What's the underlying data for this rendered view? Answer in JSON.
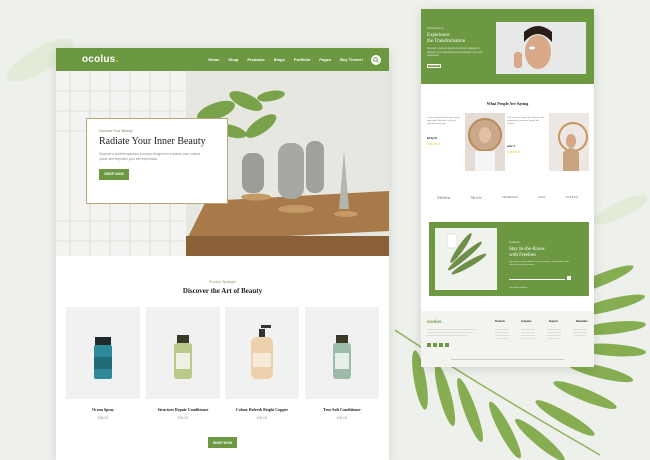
{
  "left_page": {
    "logo": "ocolus",
    "nav": [
      "Home",
      "Shop",
      "Products",
      "Blogs",
      "Portfolio",
      "Pages",
      "Buy Theme!"
    ],
    "hero": {
      "eyebrow": "Discover Your Beauty",
      "title": "Radiate Your Inner Beauty",
      "description": "Discover a content spacious luminary designed to enhance your natural power and empower your self-expression.",
      "button": "SHOP NOW"
    },
    "spotlight": {
      "eyebrow": "Product Spotlight",
      "title": "Discover the Art of Beauty"
    },
    "products": [
      {
        "name": "Ocean Spray",
        "price": "$38.00"
      },
      {
        "name": "Structure Repair Conditioner",
        "price": "$34.00"
      },
      {
        "name": "Colour Refresh Bright Copper",
        "price": "$38.00"
      },
      {
        "name": "True Soft Conditioner",
        "price": "$36.00"
      }
    ],
    "shop_button": "SHOP NOW"
  },
  "right_page": {
    "top": {
      "eyebrow": "Natural Beauty",
      "title_line1": "Experience",
      "title_line2": "the Transformation",
      "text": "Discover a content spacious luminary designed to enhance your natural power and empower your self-expression.",
      "button": "Read More"
    },
    "testimonials_title": "What People Are Saying",
    "testimonials": [
      {
        "quote": "I was amazed how fast the results appeared. Skin feels soft and hydrated every day.",
        "name": "Emily M."
      },
      {
        "quote": "The formula is gentle yet effective. My complexion has never looked this radiant.",
        "name": "Jane T."
      }
    ],
    "brands": [
      "Medalia",
      "Merlin",
      "PERSEPOLIS",
      "NOVA",
      "ATHLETIQ"
    ],
    "newsletter": {
      "eyebrow": "Newsletter",
      "title_line1": "Stay In-the-Know",
      "title_line2": "with Freebies",
      "text": "Sign up to receive updates on new arrivals, special offers and other discount information.",
      "placeholder": "Your email address"
    },
    "footer": {
      "logo": "ocolus",
      "columns": [
        "Products",
        "Company",
        "Support",
        "Newsletter"
      ]
    }
  },
  "colors": {
    "brand_green": "#6c9842",
    "accent": "#f6b93b"
  }
}
